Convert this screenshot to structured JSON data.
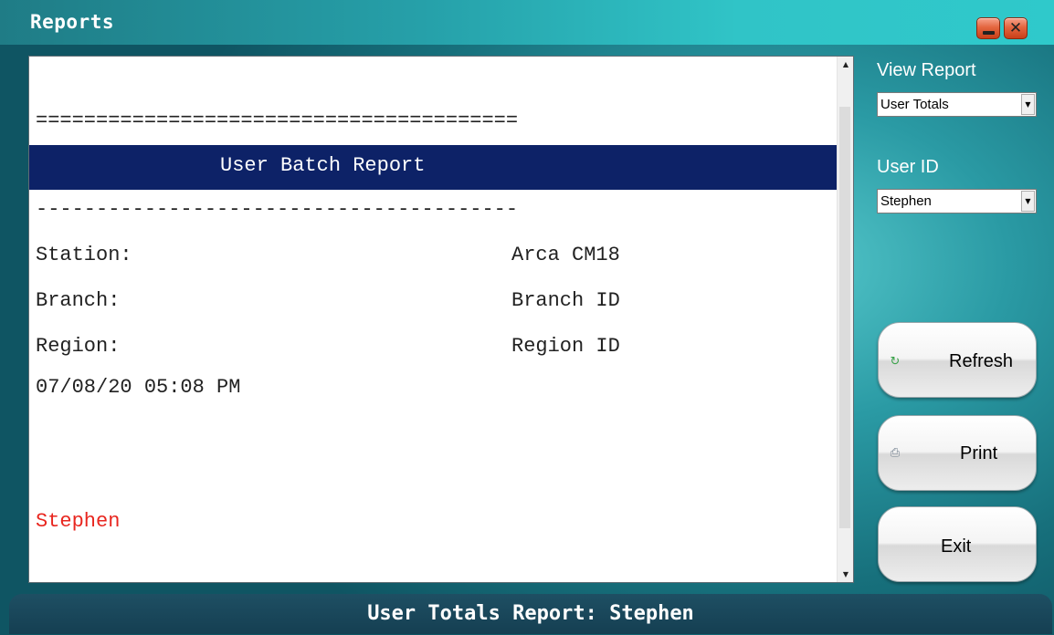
{
  "window": {
    "title": "Reports",
    "minimize_icon": "minimize-icon",
    "close_icon": "close-icon"
  },
  "report": {
    "double_rule": "========================================",
    "header_title": "User Batch Report",
    "single_rule": "----------------------------------------",
    "rows": [
      {
        "label": "Station:",
        "value": "Arca CM18"
      },
      {
        "label": "Branch:",
        "value": "Branch ID"
      },
      {
        "label": "Region:",
        "value": "Region ID"
      }
    ],
    "timestamp": "07/08/20 05:08 PM",
    "user_name": "Stephen",
    "header_band_color": "#0d2267",
    "user_name_color": "#e8261f"
  },
  "sidebar": {
    "view_report_label": "View Report",
    "view_report_value": "User Totals",
    "user_id_label": "User ID",
    "user_id_value": "Stephen"
  },
  "buttons": {
    "refresh_label": "Refresh",
    "refresh_icon": "refresh-icon",
    "print_label": "Print",
    "print_icon": "printer-icon",
    "exit_label": "Exit"
  },
  "status": {
    "text": "User Totals Report: Stephen"
  },
  "colors": {
    "background_teal": "#2a9aa4",
    "statusbar": "#153f52"
  }
}
